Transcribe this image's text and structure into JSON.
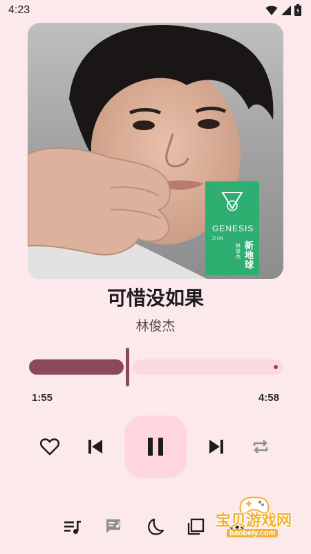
{
  "status_bar": {
    "time": "4:23",
    "icons": [
      "wifi-icon",
      "cell-signal-icon",
      "battery-icon"
    ]
  },
  "album": {
    "art": "album-cover",
    "cover_title": "GENESIS",
    "cover_small_text": "JJ LIN",
    "cover_artist_small": "林俊杰",
    "cover_chinese": "新地球"
  },
  "song": {
    "title": "可惜没如果",
    "artist": "林俊杰"
  },
  "playback": {
    "current_time": "1:55",
    "total_time": "4:58",
    "progress": 0.386
  },
  "controls": [
    "heart-icon",
    "skip-previous-icon",
    "pause-icon",
    "skip-next-icon",
    "repeat-icon"
  ],
  "bottom_bar": [
    "queue-music-icon",
    "lyrics-icon",
    "sleep-timer-icon",
    "library-icon",
    "more-icon"
  ],
  "watermark": {
    "text": "宝贝游戏网",
    "url": "baobeiy.com"
  },
  "colors": {
    "background": "#fbe9ec",
    "accent": "#8a4a5a",
    "track": "#fcd9e1",
    "play_button": "#ffd6de"
  }
}
